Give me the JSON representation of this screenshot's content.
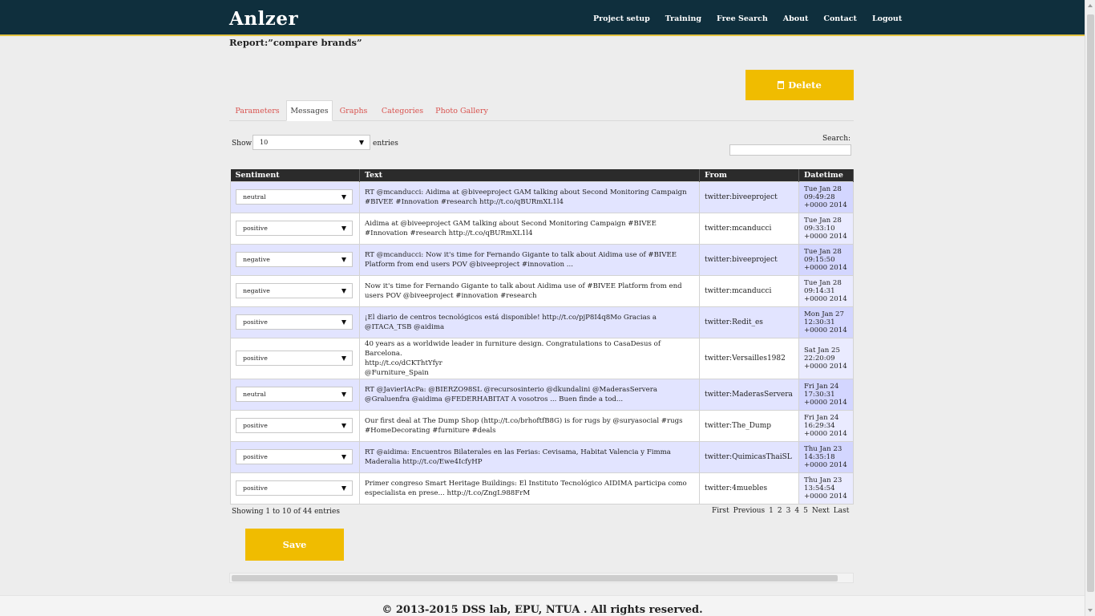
{
  "app": {
    "logo": "Anlzer"
  },
  "nav": [
    {
      "label": "Project setup"
    },
    {
      "label": "Training"
    },
    {
      "label": "Free Search"
    },
    {
      "label": "About"
    },
    {
      "label": "Contact"
    },
    {
      "label": "Logout"
    }
  ],
  "report": {
    "title": "Report:”compare brands”"
  },
  "delete_button": {
    "label": "Delete",
    "icon": "trash-icon"
  },
  "tabs": [
    {
      "label": "Parameters",
      "active": false
    },
    {
      "label": "Messages",
      "active": true
    },
    {
      "label": "Graphs",
      "active": false
    },
    {
      "label": "Categories",
      "active": false
    },
    {
      "label": "Photo Gallery",
      "active": false
    }
  ],
  "length": {
    "show_label": "Show",
    "value": "10",
    "entries_label": "entries"
  },
  "search": {
    "label": "Search:",
    "value": ""
  },
  "table": {
    "headers": [
      "Sentiment",
      "Text",
      "From",
      "Datetime"
    ],
    "rows": [
      {
        "sentiment": "neutral",
        "text": "RT @mcanducci: Aidima at @biveeproject GAM talking about Second Monitoring Campaign #BIVEE #Innovation #research http://t.co/qBURmXL1l4",
        "from": "twitter:biveeproject",
        "dt1": "Tue Jan 28",
        "dt2": "09:49:28",
        "dt3": "+0000 2014"
      },
      {
        "sentiment": "positive",
        "text": "Aidima at @biveeproject GAM talking about Second Monitoring Campaign #BIVEE #Innovation #research http://t.co/qBURmXL1l4",
        "from": "twitter:mcanducci",
        "dt1": "Tue Jan 28",
        "dt2": "09:33:10",
        "dt3": "+0000 2014"
      },
      {
        "sentiment": "negative",
        "text": "RT @mcanducci: Now it's time for Fernando Gigante to talk about Aidima use of #BIVEE Platform from end users POV @biveeproject #innovation ...",
        "from": "twitter:biveeproject",
        "dt1": "Tue Jan 28",
        "dt2": "09:15:50",
        "dt3": "+0000 2014"
      },
      {
        "sentiment": "negative",
        "text": "Now it's time for Fernando Gigante to talk about Aidima use of #BIVEE Platform from end users POV @biveeproject #innovation #research",
        "from": "twitter:mcanducci",
        "dt1": "Tue Jan 28",
        "dt2": "09:14:31",
        "dt3": "+0000 2014"
      },
      {
        "sentiment": "positive",
        "text": "¡El diario de centros tecnológicos está disponible! http://t.co/pjP8I4q8Mo Gracias a @ITACA_TSB @aidima",
        "from": "twitter:Redit_es",
        "dt1": "Mon Jan 27",
        "dt2": "12:30:31",
        "dt3": "+0000 2014"
      },
      {
        "sentiment": "positive",
        "text": "40 years as a worldwide leader in furniture design. Congratulations to CasaDesus of Barcelona.\nhttp://t.co/dCKThtYfyr\n@Furniture_Spain",
        "from": "twitter:Versailles1982",
        "dt1": "Sat Jan 25",
        "dt2": "22:20:09",
        "dt3": "+0000 2014"
      },
      {
        "sentiment": "neutral",
        "text": "RT @JavierIAcPa: @BIERZO98SL @recursosinterio @dkundalini @MaderasServera @Graluenfra @aidima @FEDERHABITAT A vosotros ... Buen finde a tod...",
        "from": "twitter:MaderasServera",
        "dt1": "Fri Jan 24",
        "dt2": "17:30:31",
        "dt3": "+0000 2014"
      },
      {
        "sentiment": "positive",
        "text": "Our first deal at The Dump Shop (http://t.co/brhoftfB8G) is for rugs by @suryasocial #rugs #HomeDecorating #furniture #deals",
        "from": "twitter:The_Dump",
        "dt1": "Fri Jan 24",
        "dt2": "16:29:34",
        "dt3": "+0000 2014"
      },
      {
        "sentiment": "positive",
        "text": "RT @aidima: Encuentros Bilaterales en las Ferias: Cevisama, Habitat Valencia y Fimma Maderalia http://t.co/Ewe4IcfyHP",
        "from": "twitter:QuimicasThaiSL",
        "dt1": "Thu Jan 23",
        "dt2": "14:35:18",
        "dt3": "+0000 2014"
      },
      {
        "sentiment": "positive",
        "text": "Primer congreso Smart Heritage Buildings: El Instituto Tecnológico AIDIMA participa como especialista en prese... http://t.co/ZngL988FrM",
        "from": "twitter:4muebles",
        "dt1": "Thu Jan 23",
        "dt2": "13:54:54",
        "dt3": "+0000 2014"
      }
    ]
  },
  "info": "Showing 1 to 10 of 44 entries",
  "paging": [
    "First",
    "Previous",
    "1",
    "2",
    "3",
    "4",
    "5",
    "Next",
    "Last"
  ],
  "save_button": {
    "label": "Save"
  },
  "footer": "© 2013-2015 DSS lab, EPU, NTUA . All rights reserved.",
  "colors": {
    "topbar": "#0f2f3d",
    "accent": "#f0bc00",
    "tab_link": "#d9534f"
  }
}
